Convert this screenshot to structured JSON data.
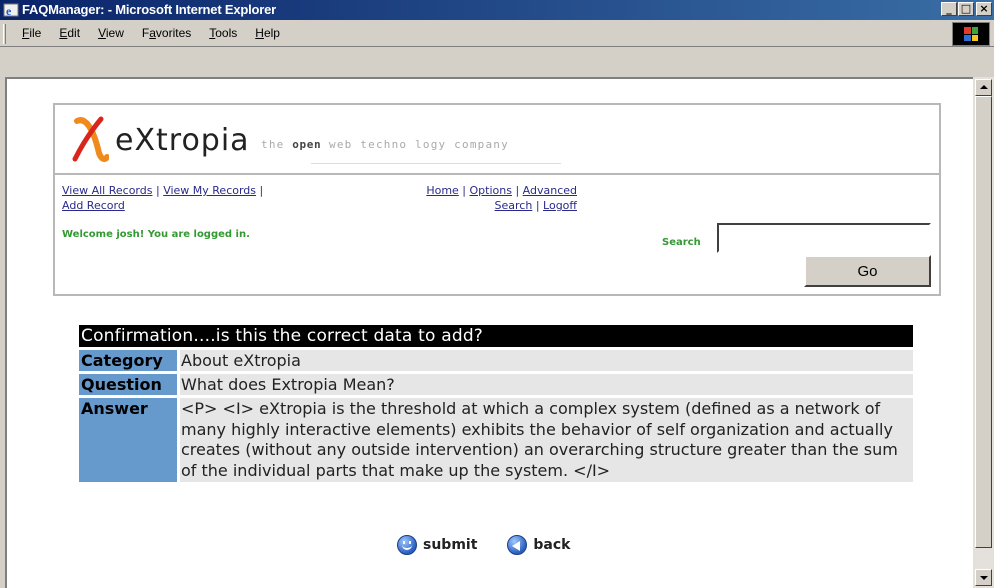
{
  "window": {
    "title": "FAQManager: - Microsoft Internet Explorer",
    "controls": [
      "minimize",
      "maximize",
      "close"
    ]
  },
  "menubar": {
    "items": [
      {
        "label": "File",
        "accel": "F"
      },
      {
        "label": "Edit",
        "accel": "E"
      },
      {
        "label": "View",
        "accel": "V"
      },
      {
        "label": "Favorites",
        "accel": "a"
      },
      {
        "label": "Tools",
        "accel": "T"
      },
      {
        "label": "Help",
        "accel": "H"
      }
    ]
  },
  "header": {
    "logo_text": "eXtropia",
    "tagline_pre": "the ",
    "tagline_bold": "open",
    "tagline_post": " web techno logy company",
    "nav_left": {
      "view_all": "View All Records",
      "view_my": "View My Records",
      "add": "Add Record"
    },
    "nav_right": {
      "home": "Home",
      "options": "Options",
      "advanced": "Advanced",
      "search": "Search",
      "logoff": "Logoff"
    },
    "welcome": "Welcome josh! You are logged in.",
    "search_label": "Search",
    "search_value": "",
    "go_label": "Go"
  },
  "confirmation": {
    "heading": "Confirmation....is this the correct data to add?",
    "rows": [
      {
        "label": "Category",
        "value": "About eXtropia"
      },
      {
        "label": "Question",
        "value": "What does Extropia Mean?"
      },
      {
        "label": "Answer",
        "value": "<P> <I> eXtropia is the threshold at which a complex system (defined as a network of many highly interactive elements) exhibits the behavior of self organization and actually creates (without any outside intervention) an overarching structure greater than the sum of the individual parts that make up the system. </I>"
      }
    ]
  },
  "actions": {
    "submit": "submit",
    "back": "back"
  },
  "colors": {
    "titlebar_start": "#0a246a",
    "label_bg": "#6699cc",
    "value_bg": "#e6e6e6",
    "welcome_green": "#339933",
    "link_blue": "#2a2a8a",
    "logo_orange": "#f08a1c"
  }
}
